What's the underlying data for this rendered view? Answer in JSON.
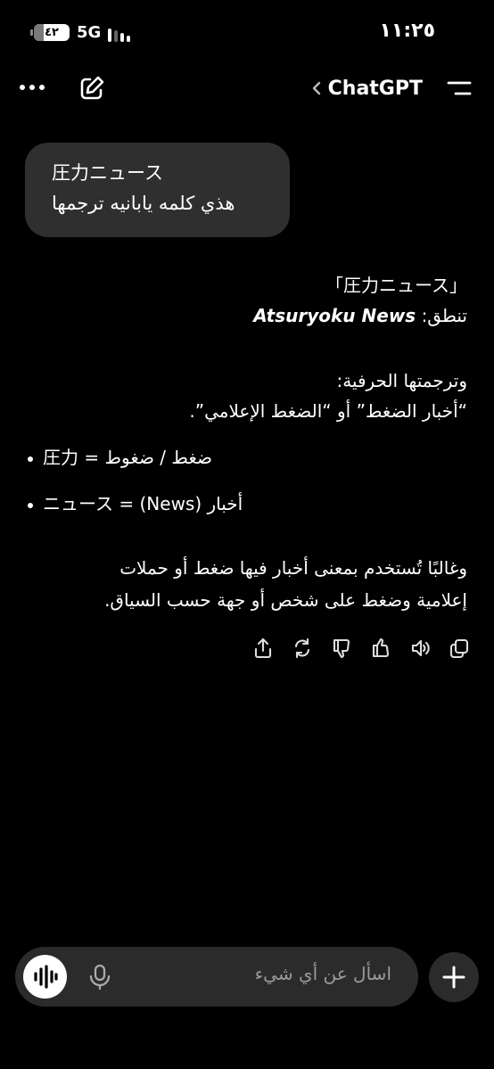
{
  "status": {
    "battery": "٤٢",
    "network": "5G",
    "time": "١١:٢٥"
  },
  "header": {
    "title": "ChatGPT"
  },
  "user_message": {
    "line1": "圧力ニュース",
    "line2": "هذي كلمه يابانيه ترجمها"
  },
  "assistant": {
    "term": "「圧力ニュース」",
    "pron_label": "تنطق:",
    "pron_value": "Atsuryoku News",
    "trans_label": "وترجمتها الحرفية:",
    "trans_value": "“أخبار الضغط” أو “الضغط الإعلامي”.",
    "bullets": [
      {
        "jp": "圧力",
        "eq": "=",
        "ar": "ضغط / ضغوط"
      },
      {
        "jp": "ニュース",
        "eq": "=",
        "ar": "أخبار (News)"
      }
    ],
    "para_line1": "وغالبًا تُستخدم بمعنى أخبار فيها ضغط أو حملات",
    "para_line2": "إعلامية وضغط على شخص أو جهة حسب السياق."
  },
  "composer": {
    "placeholder": "اسأل عن أي شيء"
  },
  "icons": [
    "share-icon",
    "regenerate-icon",
    "thumbs-down-icon",
    "thumbs-up-icon",
    "speaker-icon",
    "copy-icon",
    "voice-mode-icon",
    "microphone-icon",
    "plus-icon"
  ]
}
